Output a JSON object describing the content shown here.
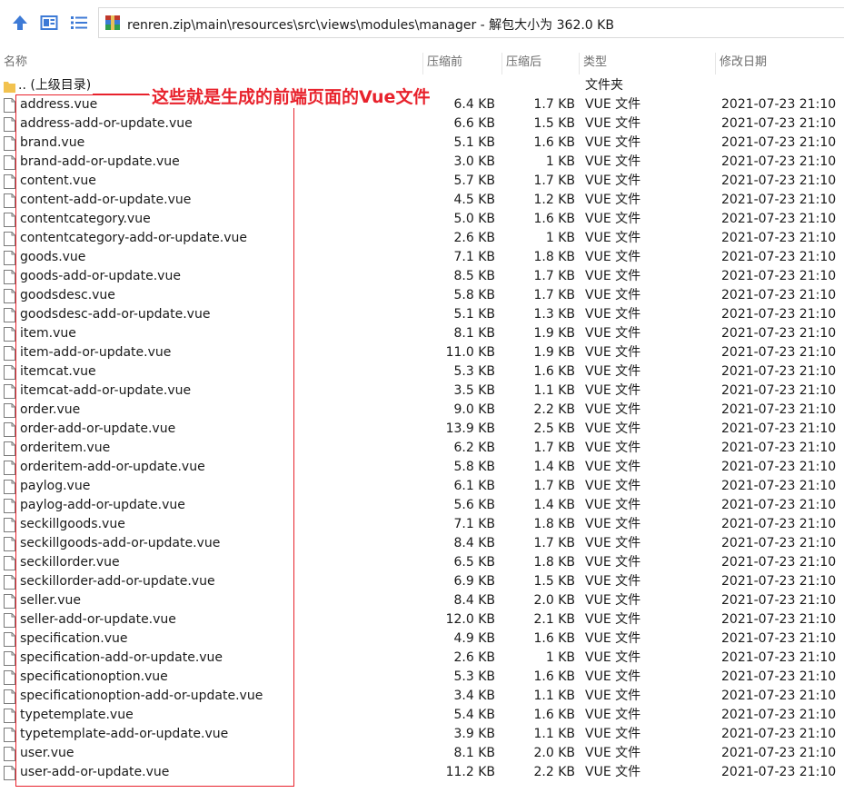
{
  "toolbar": {
    "icons": [
      "up-arrow-icon",
      "view-icon",
      "list-view-icon"
    ]
  },
  "address_bar": {
    "path": "renren.zip\\main\\resources\\src\\views\\modules\\manager - 解包大小为 362.0 KB"
  },
  "columns": {
    "name": "名称",
    "size": "压缩前",
    "packed": "压缩后",
    "type": "类型",
    "modified": "修改日期"
  },
  "parent_row": {
    "name": ".. (上级目录)",
    "type": "文件夹"
  },
  "annotation": "这些就是生成的前端页面的Vue文件",
  "colors": {
    "annotation": "#e8222c",
    "folder": "#f2c24f"
  },
  "files": [
    {
      "name": "address.vue",
      "size": "6.4 KB",
      "packed": "1.7 KB",
      "type": "VUE 文件",
      "date": "2021-07-23 21:10"
    },
    {
      "name": "address-add-or-update.vue",
      "size": "6.6 KB",
      "packed": "1.5 KB",
      "type": "VUE 文件",
      "date": "2021-07-23 21:10"
    },
    {
      "name": "brand.vue",
      "size": "5.1 KB",
      "packed": "1.6 KB",
      "type": "VUE 文件",
      "date": "2021-07-23 21:10"
    },
    {
      "name": "brand-add-or-update.vue",
      "size": "3.0 KB",
      "packed": "1 KB",
      "type": "VUE 文件",
      "date": "2021-07-23 21:10"
    },
    {
      "name": "content.vue",
      "size": "5.7 KB",
      "packed": "1.7 KB",
      "type": "VUE 文件",
      "date": "2021-07-23 21:10"
    },
    {
      "name": "content-add-or-update.vue",
      "size": "4.5 KB",
      "packed": "1.2 KB",
      "type": "VUE 文件",
      "date": "2021-07-23 21:10"
    },
    {
      "name": "contentcategory.vue",
      "size": "5.0 KB",
      "packed": "1.6 KB",
      "type": "VUE 文件",
      "date": "2021-07-23 21:10"
    },
    {
      "name": "contentcategory-add-or-update.vue",
      "size": "2.6 KB",
      "packed": "1 KB",
      "type": "VUE 文件",
      "date": "2021-07-23 21:10"
    },
    {
      "name": "goods.vue",
      "size": "7.1 KB",
      "packed": "1.8 KB",
      "type": "VUE 文件",
      "date": "2021-07-23 21:10"
    },
    {
      "name": "goods-add-or-update.vue",
      "size": "8.5 KB",
      "packed": "1.7 KB",
      "type": "VUE 文件",
      "date": "2021-07-23 21:10"
    },
    {
      "name": "goodsdesc.vue",
      "size": "5.8 KB",
      "packed": "1.7 KB",
      "type": "VUE 文件",
      "date": "2021-07-23 21:10"
    },
    {
      "name": "goodsdesc-add-or-update.vue",
      "size": "5.1 KB",
      "packed": "1.3 KB",
      "type": "VUE 文件",
      "date": "2021-07-23 21:10"
    },
    {
      "name": "item.vue",
      "size": "8.1 KB",
      "packed": "1.9 KB",
      "type": "VUE 文件",
      "date": "2021-07-23 21:10"
    },
    {
      "name": "item-add-or-update.vue",
      "size": "11.0 KB",
      "packed": "1.9 KB",
      "type": "VUE 文件",
      "date": "2021-07-23 21:10"
    },
    {
      "name": "itemcat.vue",
      "size": "5.3 KB",
      "packed": "1.6 KB",
      "type": "VUE 文件",
      "date": "2021-07-23 21:10"
    },
    {
      "name": "itemcat-add-or-update.vue",
      "size": "3.5 KB",
      "packed": "1.1 KB",
      "type": "VUE 文件",
      "date": "2021-07-23 21:10"
    },
    {
      "name": "order.vue",
      "size": "9.0 KB",
      "packed": "2.2 KB",
      "type": "VUE 文件",
      "date": "2021-07-23 21:10"
    },
    {
      "name": "order-add-or-update.vue",
      "size": "13.9 KB",
      "packed": "2.5 KB",
      "type": "VUE 文件",
      "date": "2021-07-23 21:10"
    },
    {
      "name": "orderitem.vue",
      "size": "6.2 KB",
      "packed": "1.7 KB",
      "type": "VUE 文件",
      "date": "2021-07-23 21:10"
    },
    {
      "name": "orderitem-add-or-update.vue",
      "size": "5.8 KB",
      "packed": "1.4 KB",
      "type": "VUE 文件",
      "date": "2021-07-23 21:10"
    },
    {
      "name": "paylog.vue",
      "size": "6.1 KB",
      "packed": "1.7 KB",
      "type": "VUE 文件",
      "date": "2021-07-23 21:10"
    },
    {
      "name": "paylog-add-or-update.vue",
      "size": "5.6 KB",
      "packed": "1.4 KB",
      "type": "VUE 文件",
      "date": "2021-07-23 21:10"
    },
    {
      "name": "seckillgoods.vue",
      "size": "7.1 KB",
      "packed": "1.8 KB",
      "type": "VUE 文件",
      "date": "2021-07-23 21:10"
    },
    {
      "name": "seckillgoods-add-or-update.vue",
      "size": "8.4 KB",
      "packed": "1.7 KB",
      "type": "VUE 文件",
      "date": "2021-07-23 21:10"
    },
    {
      "name": "seckillorder.vue",
      "size": "6.5 KB",
      "packed": "1.8 KB",
      "type": "VUE 文件",
      "date": "2021-07-23 21:10"
    },
    {
      "name": "seckillorder-add-or-update.vue",
      "size": "6.9 KB",
      "packed": "1.5 KB",
      "type": "VUE 文件",
      "date": "2021-07-23 21:10"
    },
    {
      "name": "seller.vue",
      "size": "8.4 KB",
      "packed": "2.0 KB",
      "type": "VUE 文件",
      "date": "2021-07-23 21:10"
    },
    {
      "name": "seller-add-or-update.vue",
      "size": "12.0 KB",
      "packed": "2.1 KB",
      "type": "VUE 文件",
      "date": "2021-07-23 21:10"
    },
    {
      "name": "specification.vue",
      "size": "4.9 KB",
      "packed": "1.6 KB",
      "type": "VUE 文件",
      "date": "2021-07-23 21:10"
    },
    {
      "name": "specification-add-or-update.vue",
      "size": "2.6 KB",
      "packed": "1 KB",
      "type": "VUE 文件",
      "date": "2021-07-23 21:10"
    },
    {
      "name": "specificationoption.vue",
      "size": "5.3 KB",
      "packed": "1.6 KB",
      "type": "VUE 文件",
      "date": "2021-07-23 21:10"
    },
    {
      "name": "specificationoption-add-or-update.vue",
      "size": "3.4 KB",
      "packed": "1.1 KB",
      "type": "VUE 文件",
      "date": "2021-07-23 21:10"
    },
    {
      "name": "typetemplate.vue",
      "size": "5.4 KB",
      "packed": "1.6 KB",
      "type": "VUE 文件",
      "date": "2021-07-23 21:10"
    },
    {
      "name": "typetemplate-add-or-update.vue",
      "size": "3.9 KB",
      "packed": "1.1 KB",
      "type": "VUE 文件",
      "date": "2021-07-23 21:10"
    },
    {
      "name": "user.vue",
      "size": "8.1 KB",
      "packed": "2.0 KB",
      "type": "VUE 文件",
      "date": "2021-07-23 21:10"
    },
    {
      "name": "user-add-or-update.vue",
      "size": "11.2 KB",
      "packed": "2.2 KB",
      "type": "VUE 文件",
      "date": "2021-07-23 21:10"
    }
  ]
}
